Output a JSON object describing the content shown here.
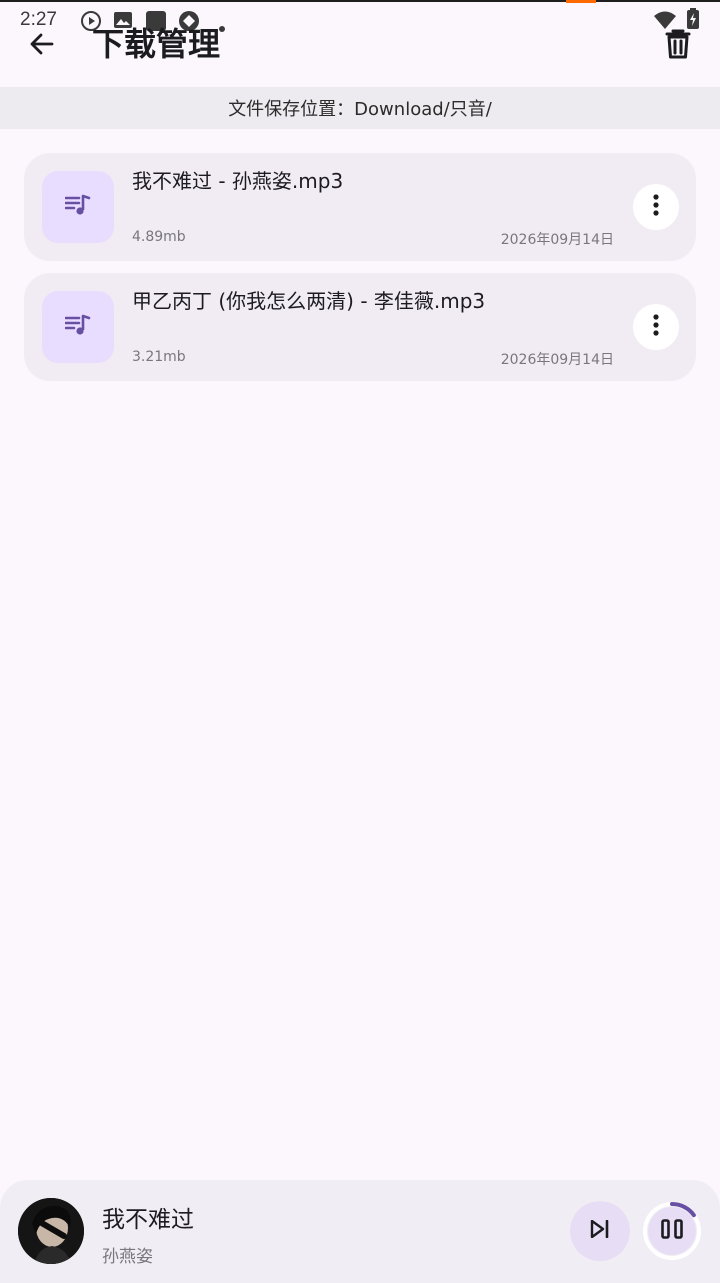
{
  "status_bar": {
    "time": "2:27"
  },
  "app_bar": {
    "title": "下载管理"
  },
  "save_location": {
    "text": "文件保存位置：Download/只音/"
  },
  "downloads": [
    {
      "title": "我不难过 - 孙燕姿.mp3",
      "size": "4.89mb",
      "date": "2026年09月14日"
    },
    {
      "title": "甲乙丙丁 (你我怎么两清) - 李佳薇.mp3",
      "size": "3.21mb",
      "date": "2026年09月14日"
    }
  ],
  "player": {
    "title": "我不难过",
    "artist": "孙燕姿",
    "progress": 0.15
  },
  "colors": {
    "background": "#FCF7FC",
    "card": "#F1ECF4",
    "thumb": "#E9DDFF",
    "accent": "#6750A4"
  },
  "icons": {
    "back": "arrow-back-icon",
    "delete": "trash-icon",
    "thumb": "playlist-music-icon",
    "more": "more-vertical-icon",
    "next": "skip-next-icon",
    "pause": "pause-icon"
  }
}
